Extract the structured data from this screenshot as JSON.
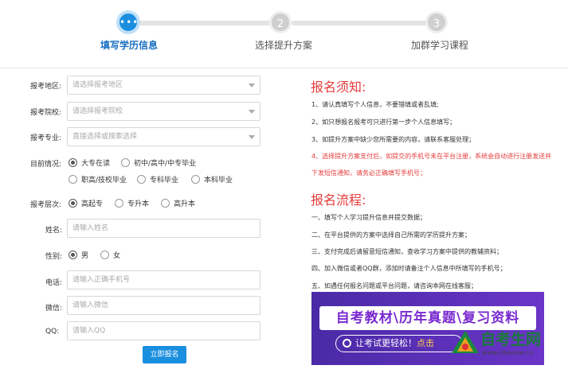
{
  "steps": [
    {
      "icon": "•••",
      "label": "填写学历信息",
      "active": true
    },
    {
      "icon": "2",
      "label": "选择提升方案",
      "active": false
    },
    {
      "icon": "3",
      "label": "加群学习课程",
      "active": false
    }
  ],
  "form": {
    "region": {
      "label": "报考地区:",
      "placeholder": "请选择报考地区"
    },
    "school": {
      "label": "报考院校:",
      "placeholder": "请选择报考院校"
    },
    "major": {
      "label": "报考专业:",
      "placeholder": "直接选择或搜索选择"
    },
    "status": {
      "label": "目前情况:",
      "options": [
        "大专在读",
        "初中/高中/中专毕业",
        "职高/技校毕业",
        "专科毕业",
        "本科毕业"
      ],
      "selected": "大专在读"
    },
    "level": {
      "label": "报考层次:",
      "options": [
        "高起专",
        "专升本",
        "高升本"
      ],
      "selected": "高起专"
    },
    "name": {
      "label": "姓名:",
      "placeholder": "请输入姓名"
    },
    "gender": {
      "label": "性别:",
      "options": [
        "男",
        "女"
      ],
      "selected": "男"
    },
    "phone": {
      "label": "电话:",
      "placeholder": "请输入正确手机号"
    },
    "wechat": {
      "label": "微信:",
      "placeholder": "请输入微信"
    },
    "qq": {
      "label": "QQ:",
      "placeholder": "请输入QQ"
    },
    "submit": "立即报名"
  },
  "notice": {
    "title": "报名须知:",
    "items": [
      "1、请认真填写个人信息，不要错填或者乱填;",
      "2、如只想报名报考可只进行第一步个人信息填写；",
      "3、如提升方案中缺少您所需要的内容，请联系客服处理；",
      "4、选择提升方案支付后，如提交的手机号未在平台注册，系统会自动进行注册发送并",
      "下发短信通知，请务必正确填写手机号；"
    ]
  },
  "process": {
    "title": "报名流程:",
    "items": [
      "一、填写个人学习提升信息并提交数据；",
      "二、在平台提供的方案中选择自己所需的学历提升方案；",
      "三、支付完成后请留意短信通知，查收学习方案中提供的教辅资料；",
      "四、加入微信或者QQ群，添加时请备注个人信息中所填写的手机号；",
      "五、如遇任何报名问题或平台问题，请咨询本网在线客服；"
    ]
  },
  "banner": {
    "title": "自考教材\\历年真题\\复习资料",
    "pill_text": "让考试更轻松！",
    "pill_highlight": "点击"
  },
  "watermark": {
    "brand": "自考生网",
    "url": "www.zikaosw.cn"
  },
  "colors": {
    "accent": "#1a8fe0",
    "red": "#e53b3b",
    "banner": "#5a2fb8"
  }
}
